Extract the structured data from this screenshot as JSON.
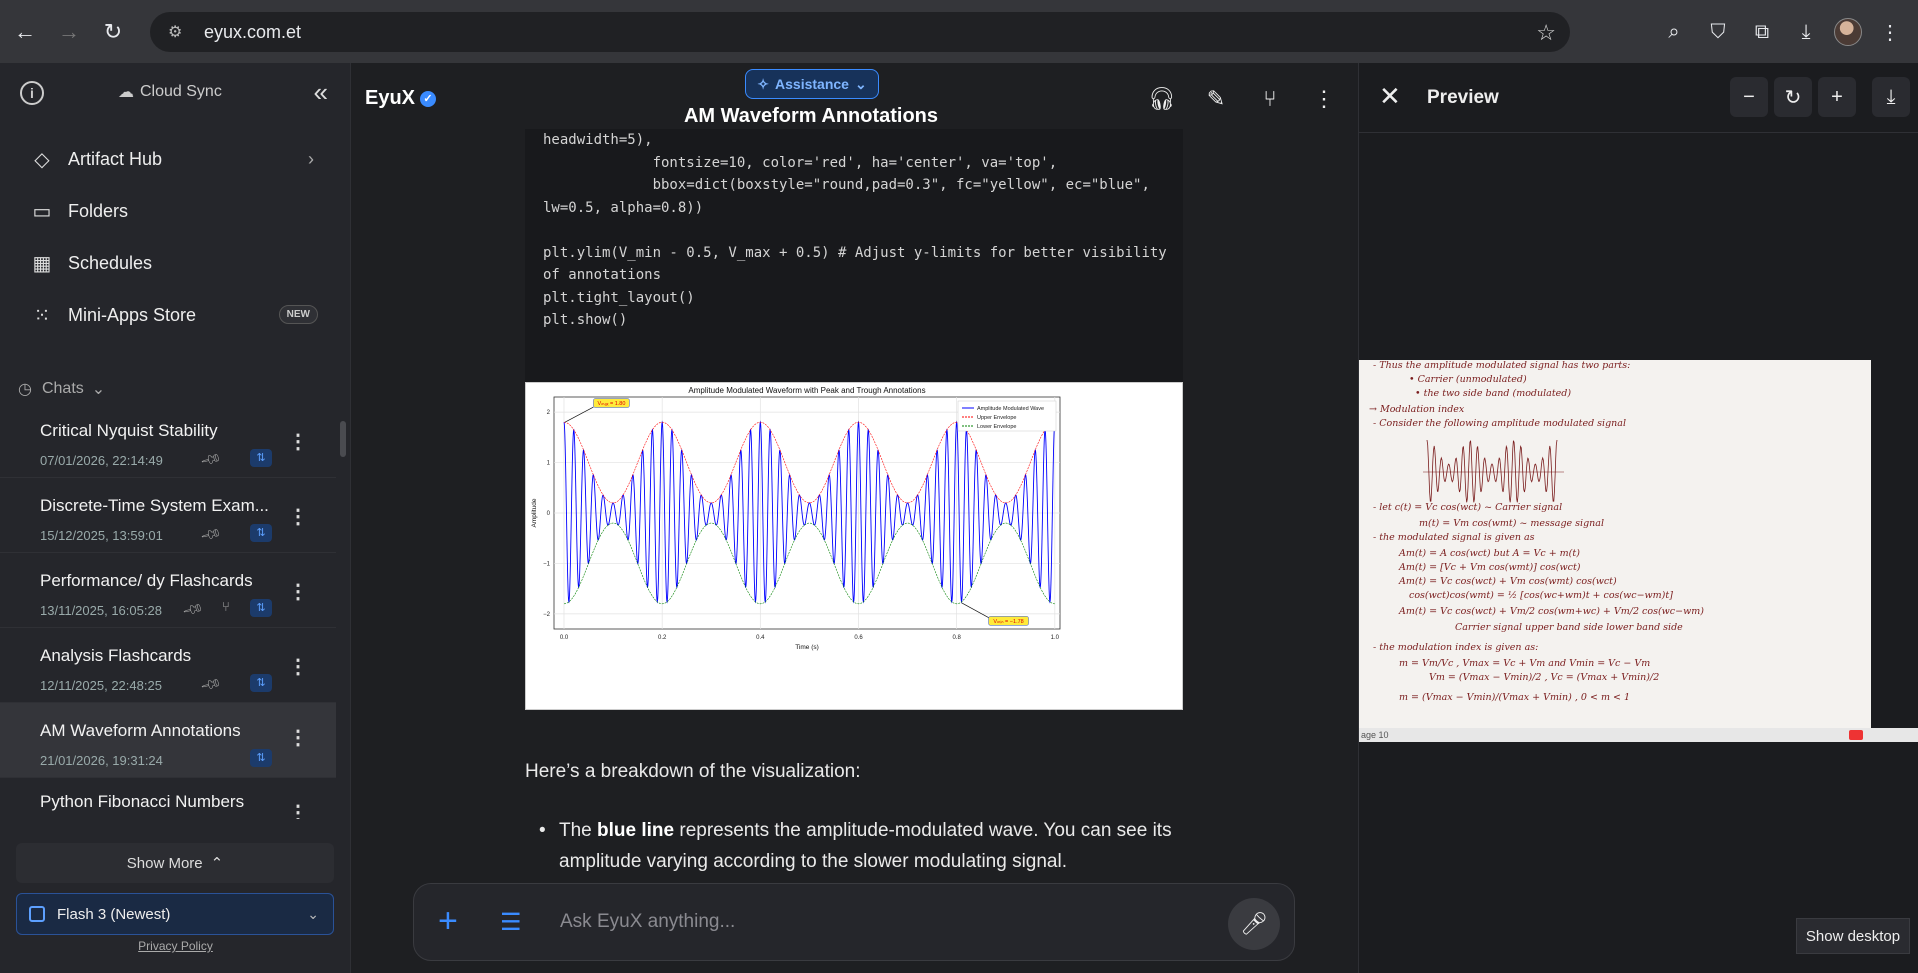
{
  "browser": {
    "url": "eyux.com.et"
  },
  "sidebar": {
    "cloud_sync": "Cloud Sync",
    "menu": [
      {
        "label": "Artifact Hub"
      },
      {
        "label": "Folders"
      },
      {
        "label": "Schedules"
      },
      {
        "label": "Mini-Apps Store",
        "badge": "NEW"
      }
    ],
    "chats_label": "Chats",
    "chats": [
      {
        "title": "Critical Nyquist Stability",
        "date": "07/01/2026, 22:14:49"
      },
      {
        "title": "Discrete-Time System Exam...",
        "date": "15/12/2025, 13:59:01"
      },
      {
        "title": "Performance/ dy Flashcards",
        "date": "13/11/2025, 16:05:28"
      },
      {
        "title": "Analysis Flashcards",
        "date": "12/11/2025, 22:48:25"
      },
      {
        "title": "AM Waveform Annotations",
        "date": "21/01/2026, 19:31:24"
      },
      {
        "title": "Python Fibonacci Numbers",
        "date": ""
      }
    ],
    "show_more": "Show More",
    "model": "Flash 3 (Newest)",
    "privacy": "Privacy Policy"
  },
  "chat": {
    "brand": "EyuX",
    "assistance": "Assistance",
    "title": "AM Waveform Annotations",
    "code": "headwidth=5),\n             fontsize=10, color='red', ha='center', va='top',\n             bbox=dict(boxstyle=\"round,pad=0.3\", fc=\"yellow\", ec=\"blue\",\nlw=0.5, alpha=0.8))\n\nplt.ylim(V_min - 0.5, V_max + 0.5) # Adjust y-limits for better visibility\nof annotations\nplt.tight_layout()\nplt.show()",
    "breakdown": "Here’s a breakdown of the visualization:",
    "bullet_bold": "blue line",
    "bullet_pre": "The ",
    "bullet_post": " represents the amplitude-modulated wave. You can see its amplitude varying according to the slower modulating signal.",
    "input_placeholder": "Ask EyuX anything..."
  },
  "chart_data": {
    "type": "line",
    "title": "Amplitude Modulated Waveform with Peak and Trough Annotations",
    "xlabel": "Time (s)",
    "ylabel": "Amplitude",
    "xlim": [
      0,
      1
    ],
    "ylim": [
      -2.3,
      2.3
    ],
    "xticks": [
      "0.0",
      "0.2",
      "0.4",
      "0.6",
      "0.8",
      "1.0"
    ],
    "yticks": [
      "2",
      "1",
      "0",
      "−1",
      "−2"
    ],
    "grid": true,
    "legend_placement": "top-right",
    "series": [
      {
        "name": "Amplitude Modulated Wave",
        "color": "#0000ff",
        "carrier_hz": 50,
        "modulating_hz": 5,
        "Vc": 1,
        "Vm": 0.8
      },
      {
        "name": "Upper Envelope",
        "color": "#ff0000",
        "dashed": true
      },
      {
        "name": "Lower Envelope",
        "color": "#008000",
        "dashed": true
      }
    ],
    "annotations": [
      {
        "text": "Vₘₐₓ = 1.80",
        "x": 0.0,
        "y": 1.8
      },
      {
        "text": "Vₘᵢₙ = −1.78",
        "x": 0.81,
        "y": -1.78
      }
    ]
  },
  "preview": {
    "title": "Preview",
    "page_label": "age 10",
    "show_desktop": "Show desktop",
    "notes": [
      "- Thus the amplitude modulated signal has two parts:",
      "• Carrier (unmodulated)",
      "• the two side band (modulated)",
      "→ Modulation index",
      "- Consider the following amplitude modulated signal",
      "- let c(t) = Vc cos(wct) ~ Carrier signal",
      "m(t) = Vm cos(wmt) ~ message signal",
      "- the modulated signal is given as",
      "Am(t) = A cos(wct) but A = Vc + m(t)",
      "Am(t) = [Vc + Vm cos(wmt)] cos(wct)",
      "Am(t) = Vc cos(wct) + Vm cos(wmt) cos(wct)",
      "cos(wct)cos(wmt) = ½ [cos(wc+wm)t + cos(wc−wm)t]",
      "Am(t) = Vc cos(wct) + Vm/2 cos(wm+wc) + Vm/2 cos(wc−wm)",
      "Carrier signal   upper band side   lower band side",
      "- the modulation index is given as:",
      "m = Vm/Vc ,  Vmax = Vc + Vm  and  Vmin = Vc − Vm",
      "Vm = (Vmax − Vmin)/2 ,  Vc = (Vmax + Vmin)/2",
      "m = (Vmax − Vmin)/(Vmax + Vmin) ,  0 < m < 1"
    ]
  }
}
